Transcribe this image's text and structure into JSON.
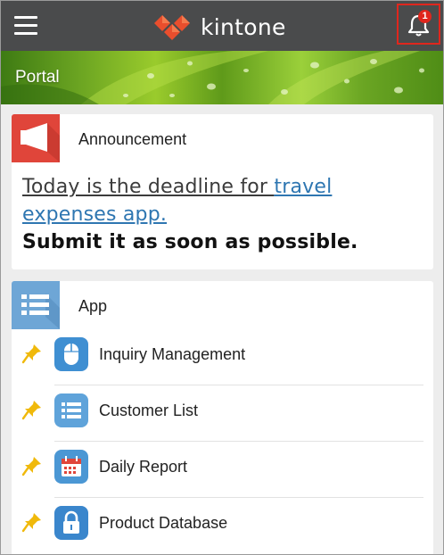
{
  "header": {
    "logo_text": "kintone",
    "notification_count": "1",
    "menu_icon": "hamburger-menu-icon",
    "notification_icon": "bell-icon"
  },
  "banner": {
    "title": "Portal"
  },
  "announcement": {
    "title": "Announcement",
    "text_before_link": "Today is the deadline for ",
    "link_text_part1": "travel",
    "link_text_part2": "expenses app.",
    "line3": "Submit it as soon as possible.",
    "icon": "megaphone-icon"
  },
  "apps": {
    "title": "App",
    "icon": "list-icon",
    "items": [
      {
        "label": "Inquiry Management",
        "icon": "mouse-icon"
      },
      {
        "label": "Customer List",
        "icon": "list-icon"
      },
      {
        "label": "Daily Report",
        "icon": "calendar-icon"
      },
      {
        "label": "Product Database",
        "icon": "lock-icon"
      }
    ]
  },
  "colors": {
    "header_bg": "#4a4b4c",
    "accent_red": "#e0261d",
    "link_blue": "#2e76b1",
    "pin_yellow": "#f0b90b"
  }
}
